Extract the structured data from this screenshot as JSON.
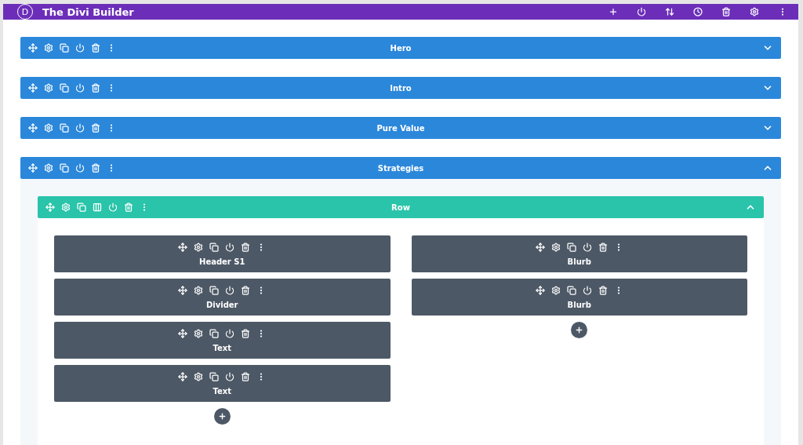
{
  "builder": {
    "logo": "D",
    "title": "The Divi Builder"
  },
  "sections": [
    {
      "label": "Hero",
      "expanded": false
    },
    {
      "label": "Intro",
      "expanded": false
    },
    {
      "label": "Pure Value",
      "expanded": false
    },
    {
      "label": "Strategies",
      "expanded": true,
      "row": {
        "label": "Row",
        "expanded": true,
        "columns": [
          {
            "modules": [
              {
                "label": "Header S1"
              },
              {
                "label": "Divider"
              },
              {
                "label": "Text"
              },
              {
                "label": "Text"
              }
            ]
          },
          {
            "modules": [
              {
                "label": "Blurb"
              },
              {
                "label": "Blurb"
              }
            ]
          }
        ]
      }
    }
  ]
}
